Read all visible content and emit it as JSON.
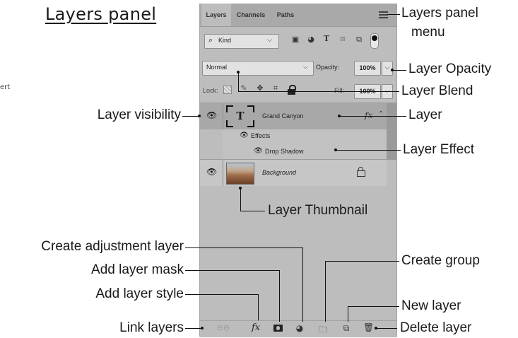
{
  "title": "Layers panel",
  "cropped_text": "ert",
  "panel": {
    "tabs": [
      "Layers",
      "Channels",
      "Paths"
    ],
    "filter_kind": "Kind",
    "blend_mode": "Normal",
    "opacity_label": "Opacity:",
    "opacity_value": "100%",
    "lock_label": "Lock:",
    "fill_label": "Fill:",
    "fill_value": "100%",
    "type_glyph": "T",
    "layer_name": "Grand Canyon",
    "fx_glyph": "fx",
    "effects_label": "Effects",
    "drop_shadow_label": "Drop Shadow",
    "background_layer": "Background"
  },
  "labels": {
    "panel_menu_1": "Layers panel",
    "panel_menu_2": "menu",
    "layer_opacity": "Layer Opacity",
    "layer_blend": "Layer Blend",
    "layer_visibility": "Layer visibility",
    "layer": "Layer",
    "layer_effect": "Layer Effect",
    "layer_thumbnail": "Layer Thumbnail",
    "create_adjustment": "Create adjustment layer",
    "add_mask": "Add layer mask",
    "add_style": "Add layer style",
    "link_layers": "Link layers",
    "create_group": "Create group",
    "new_layer": "New layer",
    "delete_layer": "Delete layer"
  },
  "icons": {
    "menu": "hamburger-icon",
    "search": "search-icon",
    "eye": "eye-icon",
    "lock": "lock-icon",
    "link": "link-icon",
    "fx": "fx-icon",
    "mask": "mask-icon",
    "adjustment": "adjustment-icon",
    "folder": "folder-icon",
    "new_layer": "new-layer-icon",
    "trash": "trash-icon"
  }
}
